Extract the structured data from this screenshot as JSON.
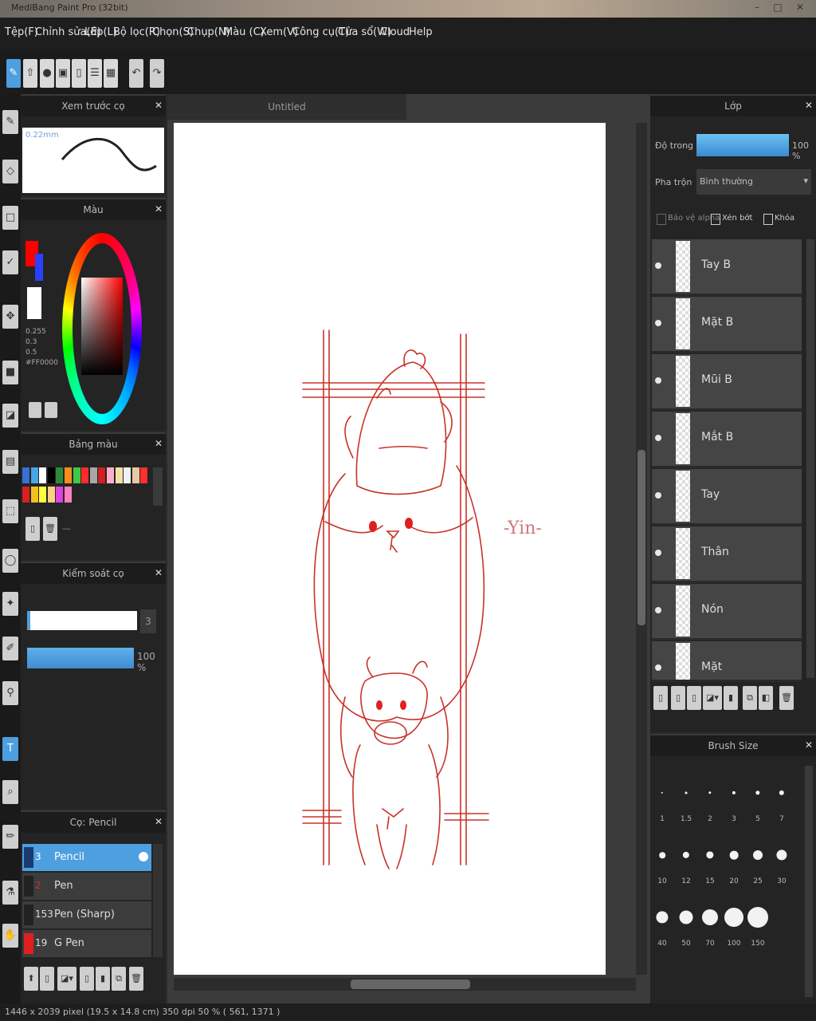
{
  "window": {
    "title": "MediBang Paint Pro (32bit)"
  },
  "menu": [
    "Tệp(F)",
    "Chỉnh sửa(E)",
    "Lớp(L)",
    "Bộ lọc(R)",
    "Chọn(S)",
    "Chụp(N)",
    "Màu (C)",
    "Xem(V)",
    "Công cụ(T)",
    "Cửa sổ(W)",
    "Cloud",
    "Help"
  ],
  "panels": {
    "brush_preview": {
      "title": "Xem trước cọ",
      "size_label": "0.22mm"
    },
    "color": {
      "title": "Màu",
      "values": [
        "0.255",
        "0.3",
        "0.5",
        "#FF0000"
      ],
      "fg_color": "#ff0000",
      "bg_color": "#ffffff"
    },
    "palette": {
      "title": "Bảng màu",
      "colors": [
        "#3b6fd0",
        "#46a6e6",
        "#ffffff",
        "#000000",
        "#2c8a3a",
        "#ff8c1a",
        "#3dc94a",
        "#ff2a2a",
        "#a8a8a8",
        "#d02020",
        "#ffb0c8",
        "#f5e0a8",
        "#f0f0f0",
        "#e8c8a0",
        "#ff3030",
        "#d82020",
        "#f0c020",
        "#ffff40",
        "#ffd080",
        "#e040e0",
        "#ff80c0"
      ],
      "extra_label": "—"
    },
    "brush_control": {
      "title": "Kiểm soát cọ",
      "size_value": "3",
      "opacity_value": "100 %"
    },
    "brush_list": {
      "title": "Cọ: Pencil",
      "items": [
        {
          "num": "3",
          "name": "Pencil",
          "selected": true
        },
        {
          "num": "2",
          "name": "Pen",
          "selected": false
        },
        {
          "num": "153",
          "name": "Pen (Sharp)",
          "selected": false
        },
        {
          "num": "19",
          "name": "G Pen",
          "selected": false
        }
      ]
    },
    "layers": {
      "title": "Lớp",
      "opacity_label": "Độ trong",
      "opacity_value": "100 %",
      "blend_label": "Pha trộn",
      "blend_value": "Bình thường",
      "checks": [
        "Bảo vệ alpha",
        "Xén bớt",
        "Khóa"
      ],
      "items": [
        "Tay B",
        "Mặt B",
        "Mũi B",
        "Mắt B",
        "Tay",
        "Thân",
        "Nón",
        "Mặt"
      ]
    },
    "brush_size": {
      "title": "Brush Size",
      "sizes": [
        "1",
        "1.5",
        "2",
        "3",
        "5",
        "7",
        "10",
        "12",
        "15",
        "20",
        "25",
        "30",
        "40",
        "50",
        "70",
        "100",
        "150"
      ]
    }
  },
  "canvas": {
    "tab": "Untitled",
    "signature": "-Yin-"
  },
  "status": {
    "text": "1446 x 2039 pixel (19.5 x 14.8 cm)  350 dpi  50 %  ( 561, 1371 )"
  }
}
